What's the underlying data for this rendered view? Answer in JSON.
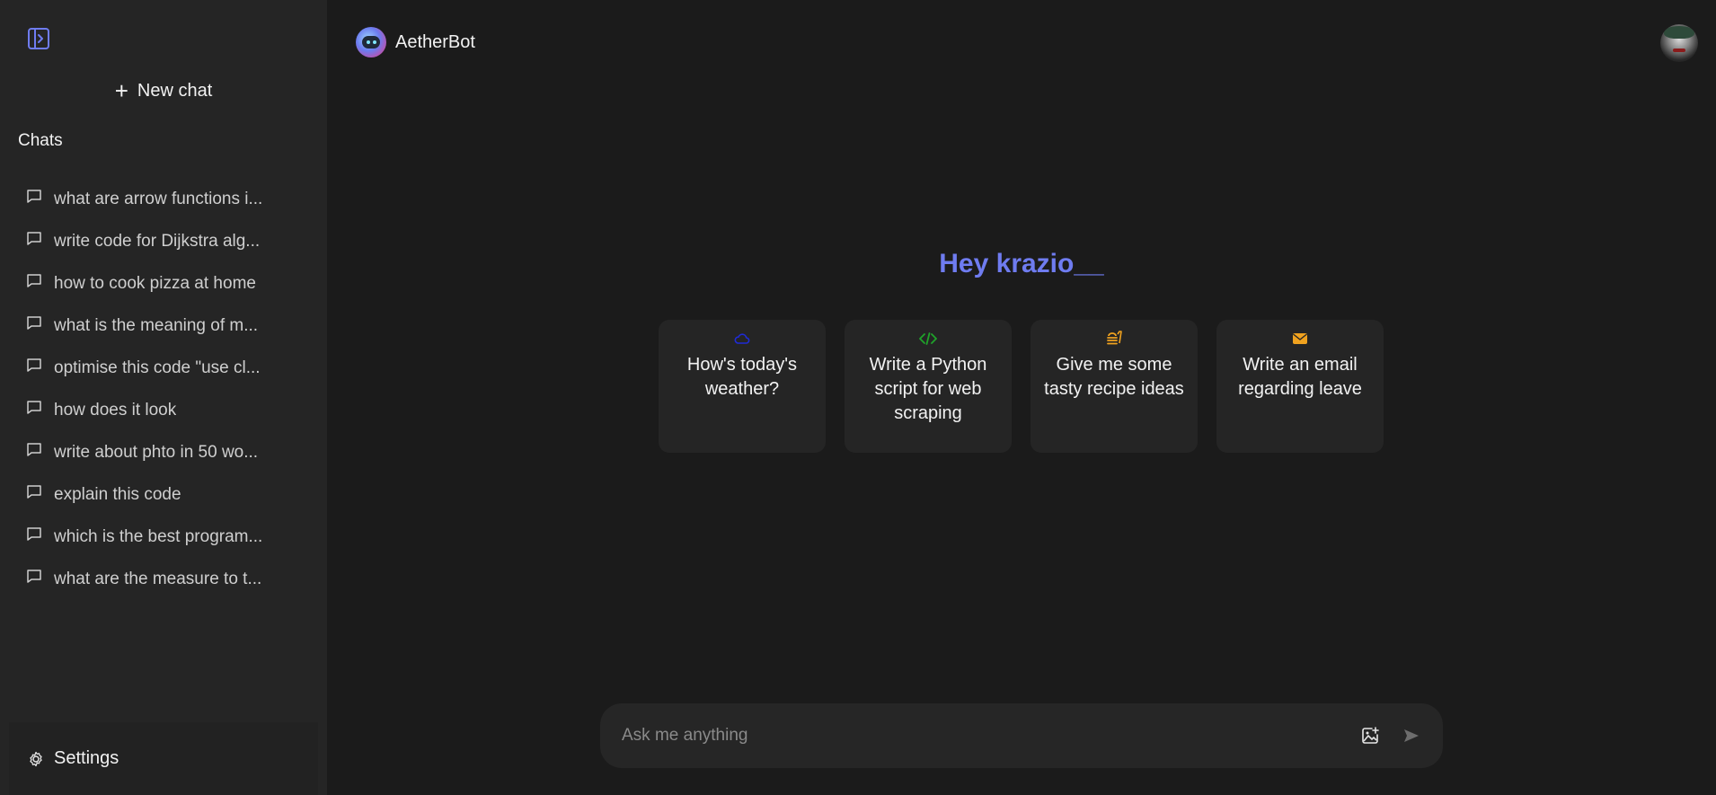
{
  "sidebar": {
    "toggle_icon": "sidebar-toggle-icon",
    "new_chat_label": "New chat",
    "chats_heading": "Chats",
    "chats": [
      {
        "label": "what are arrow functions i..."
      },
      {
        "label": "write code for Dijkstra alg..."
      },
      {
        "label": "how to cook pizza at home"
      },
      {
        "label": "what is the meaning of m..."
      },
      {
        "label": "optimise this code \"use cl..."
      },
      {
        "label": "how does it look"
      },
      {
        "label": "write about phto in 50 wo..."
      },
      {
        "label": "explain this code"
      },
      {
        "label": "which is the best program..."
      },
      {
        "label": "what are the measure to t..."
      }
    ],
    "settings_label": "Settings"
  },
  "header": {
    "brand_name": "AetherBot"
  },
  "main": {
    "greeting": "Hey krazio__",
    "cards": [
      {
        "text": "How's today's weather?",
        "icon": "cloud-icon",
        "color": "#1f2bd6"
      },
      {
        "text": "Write a Python script for web scraping",
        "icon": "code-icon",
        "color": "#1fa32a"
      },
      {
        "text": "Give me some tasty recipe ideas",
        "icon": "burger-icon",
        "color": "#f0a21f"
      },
      {
        "text": "Write an email regarding leave",
        "icon": "mail-icon",
        "color": "#f0a21f"
      }
    ]
  },
  "composer": {
    "placeholder": "Ask me anything",
    "image_button_icon": "image-add-icon",
    "send_button_icon": "send-icon"
  },
  "colors": {
    "accent": "#6f7cf0",
    "sidebar_bg": "#252525",
    "main_bg": "#1b1b1b"
  }
}
